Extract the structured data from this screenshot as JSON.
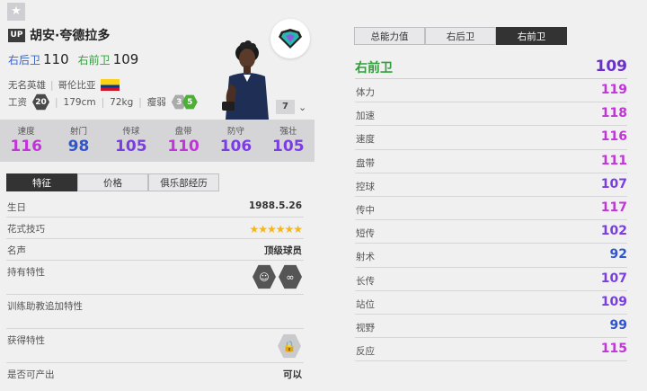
{
  "player": {
    "up_badge": "UP",
    "name": "胡安·夸德拉多",
    "positions": [
      {
        "label": "右后卫",
        "value": "110",
        "color": "#3a63c8"
      },
      {
        "label": "右前卫",
        "value": "109",
        "color": "#32a03c"
      }
    ],
    "team": "无名英雄",
    "nationality": "哥伦比亚",
    "wage_label": "工资",
    "wage": "20",
    "height": "179cm",
    "weight": "72kg",
    "body_type": "瘦弱",
    "skill_moves": "3",
    "weak_foot": "5",
    "level": "7",
    "season_badge": "diamond-season-badge-icon"
  },
  "stats": [
    {
      "label": "速度",
      "value": "116",
      "color": "#c034d8"
    },
    {
      "label": "射门",
      "value": "98",
      "color": "#3155cc"
    },
    {
      "label": "传球",
      "value": "105",
      "color": "#7a3ee0"
    },
    {
      "label": "盘带",
      "value": "110",
      "color": "#c034d8"
    },
    {
      "label": "防守",
      "value": "106",
      "color": "#7a3ee0"
    },
    {
      "label": "强壮",
      "value": "105",
      "color": "#7a3ee0"
    }
  ],
  "left_tabs": [
    "特征",
    "价格",
    "俱乐部经历"
  ],
  "traits": {
    "birthday_label": "生日",
    "birthday": "1988.5.26",
    "skill_label": "花式技巧",
    "skill_stars": "★★★★★★",
    "fame_label": "名声",
    "fame": "顶级球员",
    "owned_label": "持有特性",
    "coach_label": "训练助教追加特性",
    "acquired_label": "获得特性",
    "output_label": "是否可产出",
    "output": "可以"
  },
  "right_tabs": [
    "总能力值",
    "右后卫",
    "右前卫"
  ],
  "detail": {
    "position": "右前卫",
    "overall": "109",
    "attributes": [
      {
        "label": "体力",
        "value": "119",
        "color": "#c034d8"
      },
      {
        "label": "加速",
        "value": "118",
        "color": "#c034d8"
      },
      {
        "label": "速度",
        "value": "116",
        "color": "#c034d8"
      },
      {
        "label": "盘带",
        "value": "111",
        "color": "#c034d8"
      },
      {
        "label": "控球",
        "value": "107",
        "color": "#7a3ee0"
      },
      {
        "label": "传中",
        "value": "117",
        "color": "#c034d8"
      },
      {
        "label": "短传",
        "value": "102",
        "color": "#7a3ee0"
      },
      {
        "label": "射术",
        "value": "92",
        "color": "#3155cc"
      },
      {
        "label": "长传",
        "value": "107",
        "color": "#7a3ee0"
      },
      {
        "label": "站位",
        "value": "109",
        "color": "#7a3ee0"
      },
      {
        "label": "视野",
        "value": "99",
        "color": "#3155cc"
      },
      {
        "label": "反应",
        "value": "115",
        "color": "#c034d8"
      }
    ]
  }
}
